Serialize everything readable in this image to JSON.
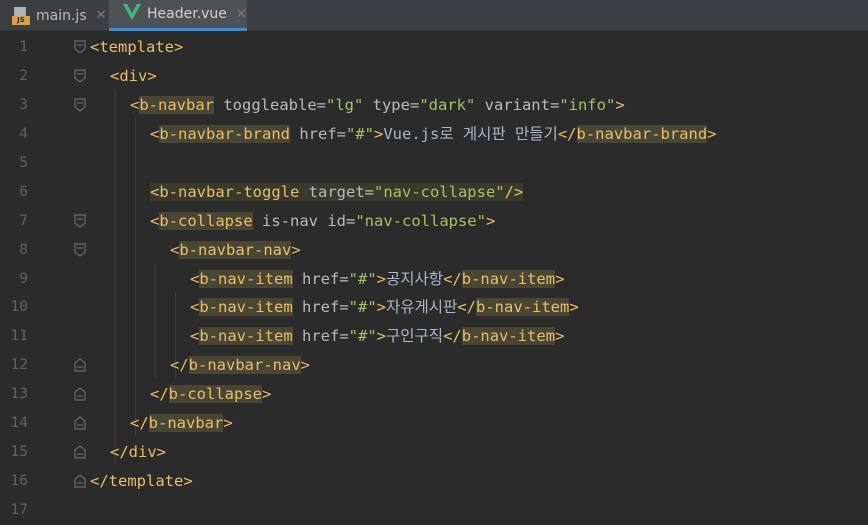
{
  "tabs": [
    {
      "name": "main.js",
      "icon": "js-file-icon",
      "close": "✕",
      "active": false
    },
    {
      "name": "Header.vue",
      "icon": "vue-file-icon",
      "close": "✕",
      "active": true
    }
  ],
  "colors": {
    "background": "#2b2b2b",
    "tag": "#e8bf6a",
    "attribute": "#bababa",
    "value": "#a5c261",
    "text": "#a9b7c6",
    "line_number": "#606366"
  },
  "line_numbers": [
    "1",
    "2",
    "3",
    "4",
    "5",
    "6",
    "7",
    "8",
    "9",
    "10",
    "11",
    "12",
    "13",
    "14",
    "15",
    "16",
    "17"
  ],
  "code": {
    "l1": {
      "open": "<template>"
    },
    "l2": {
      "open": "<div>"
    },
    "l3": {
      "lt": "<",
      "tag": "b-navbar",
      "a1": " toggleable=",
      "v1": "\"lg\"",
      "a2": " type=",
      "v2": "\"dark\"",
      "a3": " variant=",
      "v3": "\"info\"",
      "gt": ">"
    },
    "l4": {
      "lt": "<",
      "tag": "b-navbar-brand",
      "a1": " href=",
      "v1": "\"#\"",
      "gt": ">",
      "text": "Vue.js로 게시판 만들기",
      "close_lt": "</",
      "close_tag": "b-navbar-brand",
      "close_gt": ">"
    },
    "l6": {
      "lt": "<",
      "tag": "b-navbar-toggle",
      "a1": " target=",
      "v1": "\"nav-collapse\"",
      "end": "/>"
    },
    "l7": {
      "lt": "<",
      "tag": "b-collapse",
      "a1": " is-nav id=",
      "v1": "\"nav-collapse\"",
      "gt": ">"
    },
    "l8": {
      "lt": "<",
      "tag": "b-navbar-nav",
      "gt": ">"
    },
    "l9": {
      "lt": "<",
      "tag": "b-nav-item",
      "a1": " href=",
      "v1": "\"#\"",
      "gt": ">",
      "text": "공지사항",
      "close_lt": "</",
      "close_tag": "b-nav-item",
      "close_gt": ">"
    },
    "l10": {
      "lt": "<",
      "tag": "b-nav-item",
      "a1": " href=",
      "v1": "\"#\"",
      "gt": ">",
      "text": "자유게시판",
      "close_lt": "</",
      "close_tag": "b-nav-item",
      "close_gt": ">"
    },
    "l11": {
      "lt": "<",
      "tag": "b-nav-item",
      "a1": " href=",
      "v1": "\"#\"",
      "gt": ">",
      "text": "구인구직",
      "close_lt": "</",
      "close_tag": "b-nav-item",
      "close_gt": ">"
    },
    "l12": {
      "lt": "</",
      "tag": "b-navbar-nav",
      "gt": ">"
    },
    "l13": {
      "lt": "</",
      "tag": "b-collapse",
      "gt": ">"
    },
    "l14": {
      "lt": "</",
      "tag": "b-navbar",
      "gt": ">"
    },
    "l15": {
      "open": "</div>"
    },
    "l16": {
      "open": "</template>"
    }
  }
}
